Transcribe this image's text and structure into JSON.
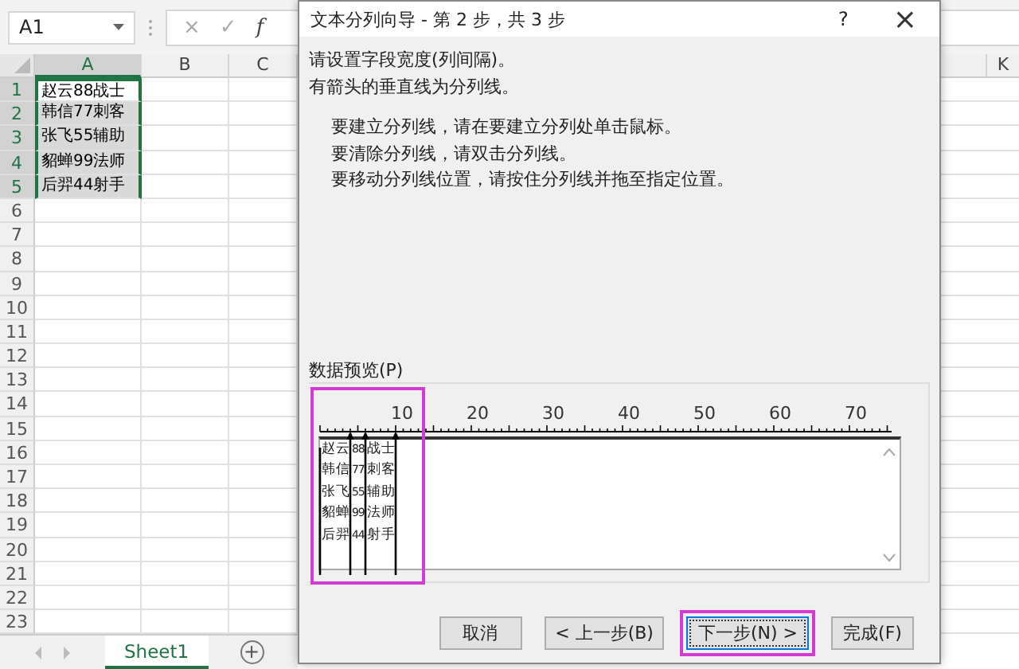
{
  "excel": {
    "name_box": "A1",
    "formula_buttons": [
      "×",
      "✓",
      "f"
    ],
    "columns": [
      "A",
      "B",
      "C"
    ],
    "rows": [
      {
        "row": "1",
        "value": "赵云88战士",
        "selected": true,
        "active": true
      },
      {
        "row": "2",
        "value": "韩信77刺客",
        "selected": true,
        "active": false
      },
      {
        "row": "3",
        "value": "张飞55辅助",
        "selected": true,
        "active": false
      },
      {
        "row": "4",
        "value": "貂蝉99法师",
        "selected": true,
        "active": false
      },
      {
        "row": "5",
        "value": "后羿44射手",
        "selected": true,
        "active": false
      },
      {
        "row": "6"
      },
      {
        "row": "7"
      },
      {
        "row": "8"
      },
      {
        "row": "9"
      },
      {
        "row": "10"
      },
      {
        "row": "11"
      },
      {
        "row": "12"
      },
      {
        "row": "13"
      },
      {
        "row": "14"
      },
      {
        "row": "15"
      },
      {
        "row": "16"
      },
      {
        "row": "17"
      },
      {
        "row": "18"
      },
      {
        "row": "19"
      },
      {
        "row": "20"
      },
      {
        "row": "21"
      },
      {
        "row": "22"
      },
      {
        "row": "23"
      }
    ],
    "sheet_tabs": [
      {
        "label": "Sheet1",
        "selected": true
      }
    ],
    "add_sheet": "+",
    "right_columns": [
      "K"
    ]
  },
  "dialog": {
    "title": "文本分列向导 - 第 2 步，共 3 步",
    "help": "?",
    "close": "×",
    "intro": [
      "请设置字段宽度(列间隔)。",
      "有箭头的垂直线为分列线。"
    ],
    "instructions": [
      "要建立分列线，请在要建立分列处单击鼠标。",
      "要清除分列线，请双击分列线。",
      "要移动分列线位置，请按住分列线并拖至指定位置。"
    ],
    "preview": {
      "label": "数据预览(P)",
      "highlighted": true,
      "ruler": [
        "10",
        "20",
        "30",
        "40",
        "50",
        "60",
        "70"
      ],
      "rows": [
        [
          "赵云",
          "88",
          "战士"
        ],
        [
          "韩信",
          "77",
          "刺客"
        ],
        [
          "张飞",
          "55",
          "辅助"
        ],
        [
          "貂蝉",
          "99",
          "法师"
        ],
        [
          "后羿",
          "44",
          "射手"
        ]
      ]
    },
    "buttons": [
      {
        "label": "取消",
        "highlighted": false
      },
      {
        "label": "< 上一步(B)",
        "highlighted": false
      },
      {
        "label": "下一步(N) >",
        "highlighted": true
      },
      {
        "label": "完成(F)",
        "highlighted": false
      }
    ]
  }
}
